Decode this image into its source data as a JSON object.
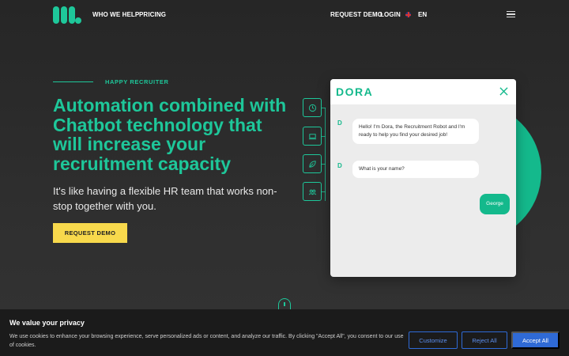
{
  "nav": {
    "who_we_help": "WHO WE HELP",
    "pricing": "PRICING",
    "request_demo": "REQUEST DEMO",
    "login": "LOGIN",
    "language": "EN"
  },
  "hero": {
    "eyebrow": "HAPPY RECRUITER",
    "title": "Automation combined with Chatbot technology that will increase your recruitment capacity",
    "subtitle": "It's like having a flexible HR team that works non-stop together with you.",
    "cta": "REQUEST DEMO"
  },
  "chat": {
    "brand": "DORA",
    "bot_initial": "D",
    "messages": [
      {
        "from": "bot",
        "text": "Hello! I'm Dora, the Recruitment Robot and I'm ready to help you find your desired job!"
      },
      {
        "from": "bot",
        "text": "What is your name?"
      },
      {
        "from": "user",
        "text": "George"
      }
    ]
  },
  "cookie": {
    "title": "We value your privacy",
    "text": "We use cookies to enhance your browsing experience, serve personalized ads or content, and analyze our traffic. By clicking \"Accept All\", you consent to our use of cookies.",
    "customize": "Customize",
    "reject": "Reject All",
    "accept": "Accept All"
  },
  "colors": {
    "accent": "#1ec79a",
    "cta": "#f8d94c",
    "cookie_button": "#2f6ad6",
    "background": "#2b2b2b"
  },
  "icons": [
    "logo-icon",
    "flag-uk-icon",
    "hamburger-icon",
    "clock-icon",
    "laptop-icon",
    "leaf-icon",
    "people-icon",
    "close-icon",
    "scroll-mouse-icon"
  ]
}
